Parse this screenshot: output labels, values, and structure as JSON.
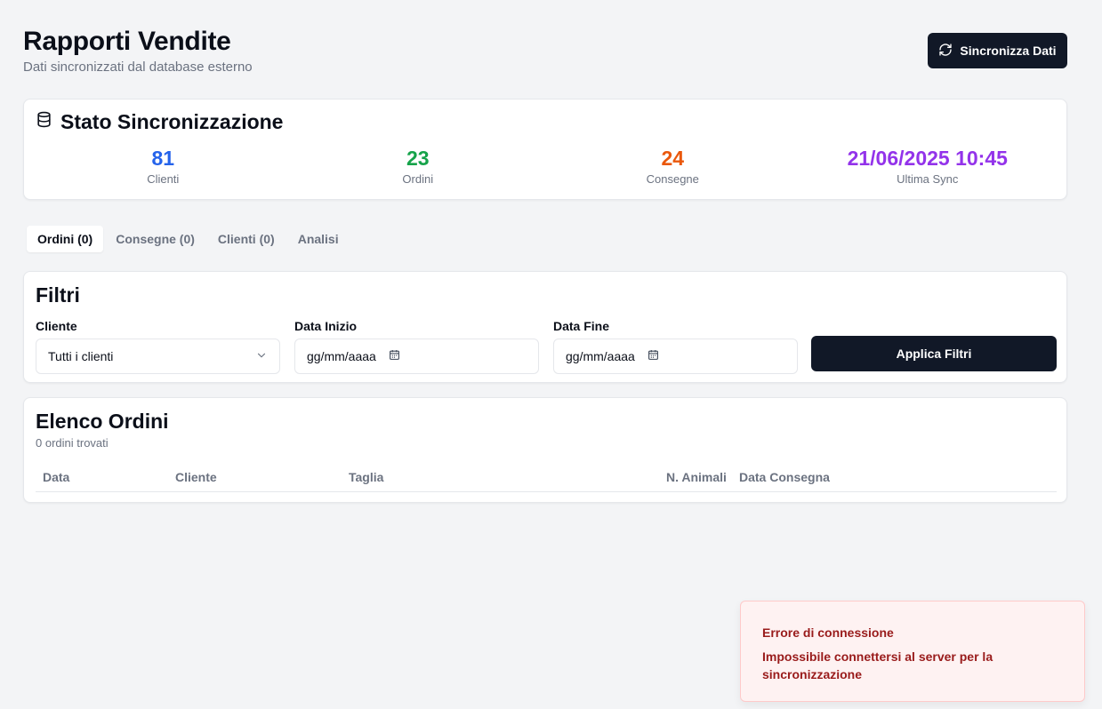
{
  "header": {
    "title": "Rapporti Vendite",
    "subtitle": "Dati sincronizzati dal database esterno",
    "sync_button_label": "Sincronizza Dati"
  },
  "status": {
    "title": "Stato Sincronizzazione",
    "icon": "database-icon",
    "stats": [
      {
        "value": "81",
        "label": "Clienti",
        "color": "#2563eb"
      },
      {
        "value": "23",
        "label": "Ordini",
        "color": "#16a34a"
      },
      {
        "value": "24",
        "label": "Consegne",
        "color": "#ea580c"
      },
      {
        "value": "21/06/2025 10:45",
        "label": "Ultima Sync",
        "color": "#9333ea"
      }
    ]
  },
  "tabs": [
    {
      "label": "Ordini (0)",
      "active": true
    },
    {
      "label": "Consegne (0)",
      "active": false
    },
    {
      "label": "Clienti (0)",
      "active": false
    },
    {
      "label": "Analisi",
      "active": false
    }
  ],
  "filters": {
    "title": "Filtri",
    "client_label": "Cliente",
    "client_value": "Tutti i clienti",
    "start_label": "Data Inizio",
    "start_placeholder": "gg/mm/aaaa",
    "end_label": "Data Fine",
    "end_placeholder": "gg/mm/aaaa",
    "apply_label": "Applica Filtri"
  },
  "orders": {
    "title": "Elenco Ordini",
    "count_text": "0 ordini trovati",
    "columns": [
      "Data",
      "Cliente",
      "Taglia",
      "N. Animali",
      "Data Consegna"
    ]
  },
  "toast": {
    "title": "Errore di connessione",
    "message": "Impossibile connettersi al server per la sincronizzazione"
  }
}
